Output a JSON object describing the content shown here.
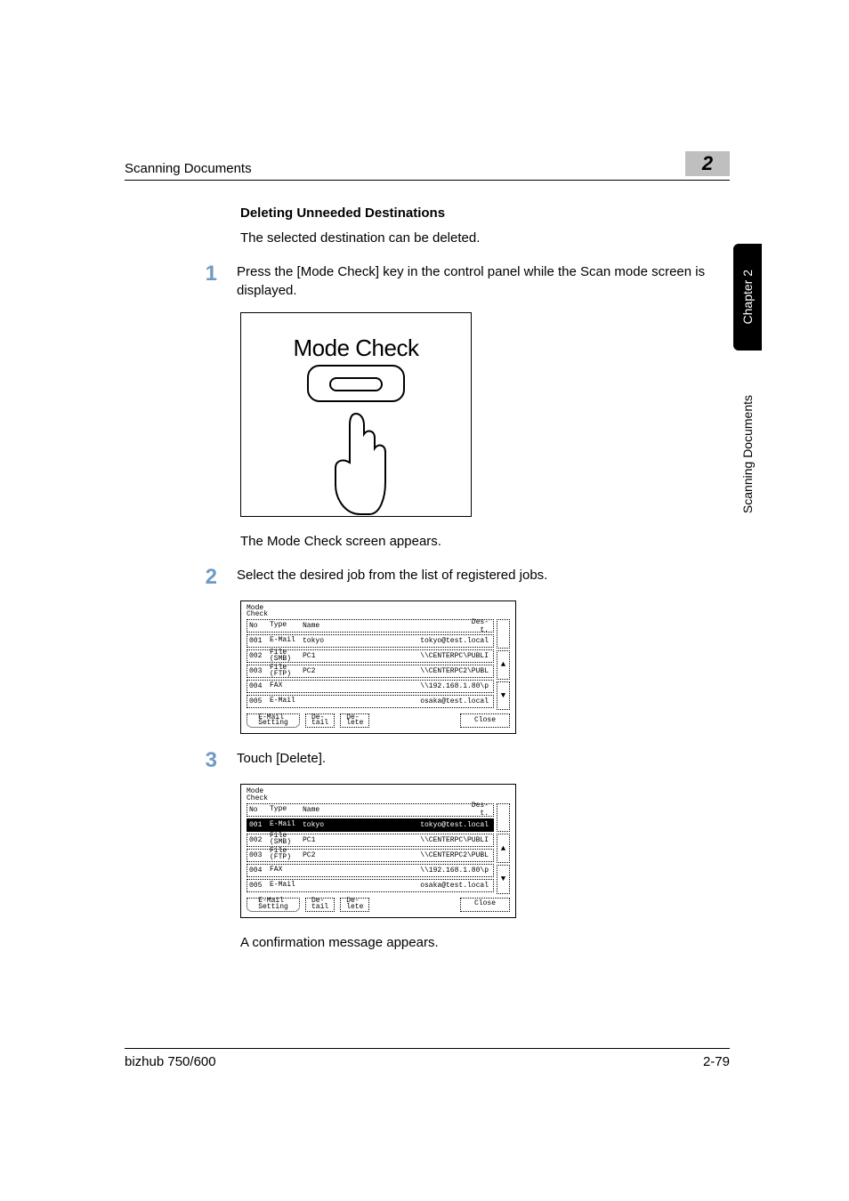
{
  "header": {
    "section": "Scanning Documents",
    "chapter_number": "2"
  },
  "side_tabs": {
    "chapter": "Chapter 2",
    "section": "Scanning Documents"
  },
  "subheading": "Deleting Unneeded Destinations",
  "intro": "The selected destination can be deleted.",
  "steps": [
    {
      "num": "1",
      "text": "Press the [Mode Check] key in the control panel while the Scan mode screen is displayed."
    },
    {
      "num": "2",
      "text": "Select the desired job from the list of registered jobs."
    },
    {
      "num": "3",
      "text": "Touch [Delete]."
    }
  ],
  "fig1": {
    "label": "Mode Check"
  },
  "after_fig1": "The Mode Check screen appears.",
  "after_fig3": "A confirmation message appears.",
  "screen": {
    "title_l1": "Mode",
    "title_l2": "Check",
    "cols": {
      "no": "No",
      "type": "Type",
      "name": "Name",
      "dest_l1": "Des-",
      "dest_l2": "t."
    },
    "rows": [
      {
        "no": "001",
        "type": "E-Mail",
        "name": "tokyo",
        "dest": "tokyo@test.local"
      },
      {
        "no": "002",
        "type": "File (SMB)",
        "name": "PC1",
        "dest": "\\\\CENTERPC\\PUBLI"
      },
      {
        "no": "003",
        "type": "File (FTP)",
        "name": "PC2",
        "dest": "\\\\CENTERPC2\\PUBL"
      },
      {
        "no": "004",
        "type": "FAX",
        "name": "",
        "dest": "\\\\192.168.1.80\\p"
      },
      {
        "no": "005",
        "type": "E-Mail",
        "name": "",
        "dest": "osaka@test.local"
      }
    ],
    "buttons": {
      "email_l1": "E-Mail",
      "email_l2": "Setting",
      "detail_l1": "De-",
      "detail_l2": "tail",
      "delete_l1": "De-",
      "delete_l2": "lete",
      "close": "Close"
    },
    "arrows": {
      "up": "▲",
      "down": "▼"
    }
  },
  "footer": {
    "model": "bizhub 750/600",
    "page": "2-79"
  }
}
